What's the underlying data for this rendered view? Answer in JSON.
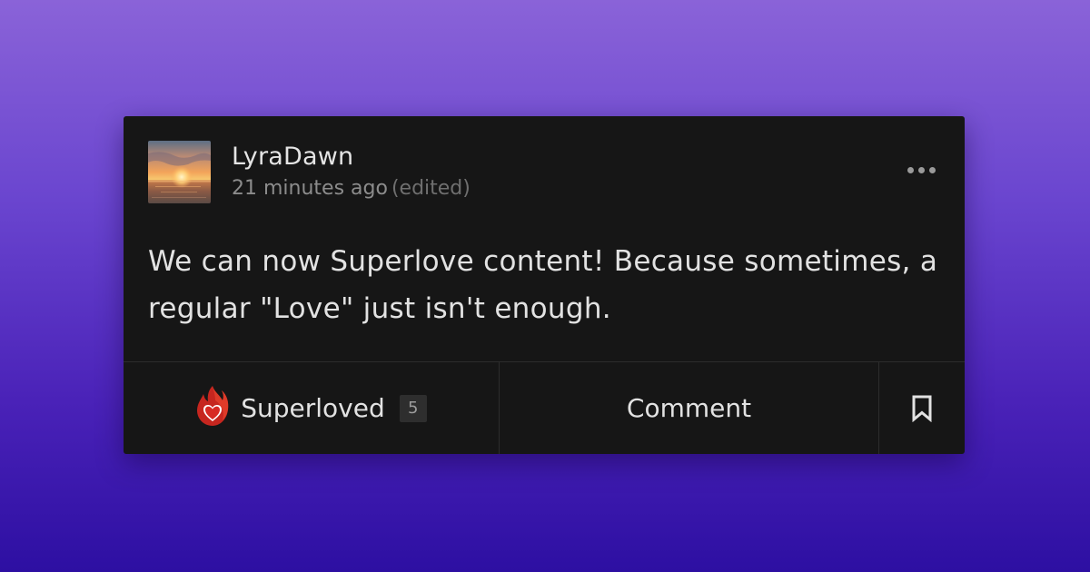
{
  "post": {
    "author": {
      "username": "LyraDawn",
      "avatar_icon": "sunset-avatar"
    },
    "timestamp": "21 minutes ago",
    "edited_label": "(edited)",
    "body": "We can now Superlove content! Because sometimes, a regular \"Love\" just isn't enough.",
    "more_icon": "more-horizontal-icon"
  },
  "actions": {
    "superlove": {
      "label": "Superloved",
      "count": "5",
      "icon": "fire-heart-icon"
    },
    "comment": {
      "label": "Comment"
    },
    "bookmark": {
      "icon": "bookmark-icon"
    }
  },
  "colors": {
    "card_bg": "#161616",
    "text": "#e2e2e2",
    "muted": "#8c8c8c",
    "background_top": "#8a63d8",
    "background_bottom": "#2d0fa2",
    "fire": "#e3352b"
  }
}
